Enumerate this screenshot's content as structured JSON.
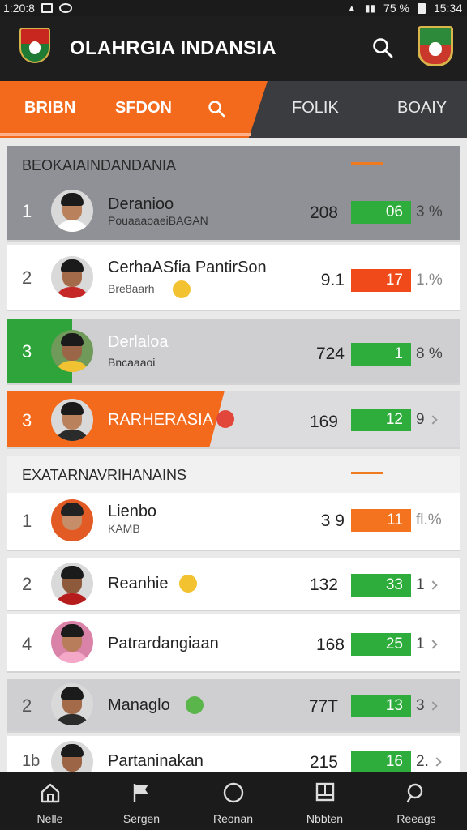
{
  "status_bar": {
    "time_left": "1:20:8",
    "battery": "75 %",
    "time_right": "15:34"
  },
  "app": {
    "title": "OLAHRGIA INDANSIA"
  },
  "tabs": [
    {
      "label": "BRIBN"
    },
    {
      "label": "SFDON"
    },
    {
      "label": "FOLIK"
    },
    {
      "label": "BOAIY"
    }
  ],
  "sections": [
    {
      "title": "BEOKAIAINDANDANIA",
      "rows": [
        {
          "rank": "1",
          "name": "Deranioo",
          "sub": "PouaaaoaeiBAGAN",
          "value": "208",
          "bar": "06",
          "bar_color": "green",
          "tail": "3 %"
        },
        {
          "rank": "2",
          "name": "CerhaASfia PantirSon",
          "sub": "Bre8aarh",
          "value": "9.1",
          "bar": "17",
          "bar_color": "red",
          "tail": "1.%"
        },
        {
          "rank": "3",
          "name": "Derlaloa",
          "sub": "Bncaaaoi",
          "value": "724",
          "bar": "1",
          "bar_color": "green",
          "tail": "8 %"
        },
        {
          "rank": "3",
          "name": "RARHERASIA",
          "sub": "",
          "value": "169",
          "bar": "12",
          "bar_color": "green",
          "tail": "9"
        }
      ]
    },
    {
      "title": "EXATARNAVRIHANAINS",
      "rows": [
        {
          "rank": "1",
          "name": "Lienbo",
          "sub": "KAMB",
          "value": "3 9",
          "bar": "11",
          "bar_color": "orange",
          "tail": "fl.%"
        },
        {
          "rank": "2",
          "name": "Reanhie",
          "sub": "",
          "value": "132",
          "bar": "33",
          "bar_color": "green",
          "tail": "1"
        },
        {
          "rank": "4",
          "name": "Patrardangiaan",
          "sub": "",
          "value": "168",
          "bar": "25",
          "bar_color": "green",
          "tail": "1"
        },
        {
          "rank": "2",
          "name": "Managlo",
          "sub": "",
          "value": "77T",
          "bar": "13",
          "bar_color": "green",
          "tail": "3"
        },
        {
          "rank": "1b",
          "name": "Partaninakan",
          "sub": "",
          "value": "215",
          "bar": "16",
          "bar_color": "green",
          "tail": "2."
        }
      ]
    }
  ],
  "bottom_nav": [
    {
      "label": "Nelle",
      "icon": "home-icon"
    },
    {
      "label": "Sergen",
      "icon": "flag-icon"
    },
    {
      "label": "Reonan",
      "icon": "circle-icon"
    },
    {
      "label": "Nbbten",
      "icon": "window-icon"
    },
    {
      "label": "Reeags",
      "icon": "search-icon"
    }
  ],
  "colors": {
    "accent": "#f36a1c",
    "green": "#2eac3c",
    "red": "#f04a1a",
    "bar_bg": "#1e1e1e"
  }
}
